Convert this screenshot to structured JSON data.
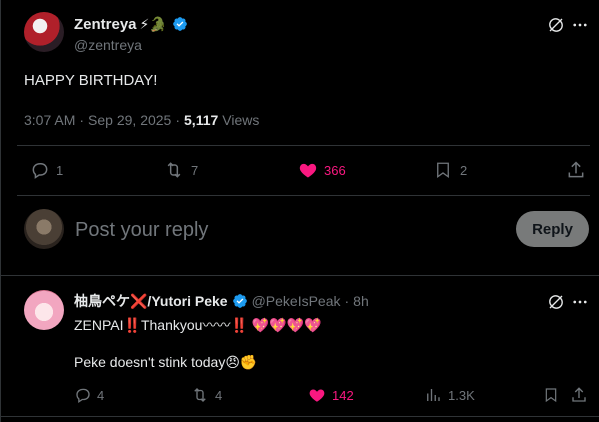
{
  "main_post": {
    "display_name": "Zentreya",
    "name_emojis": "⚡🐊",
    "handle": "@zentreya",
    "text": "HAPPY BIRTHDAY!",
    "time": "3:07 AM",
    "sep": "·",
    "date": "Sep 29, 2025",
    "views_count": "5,117",
    "views_label": "Views",
    "replies": "1",
    "reposts": "7",
    "likes": "366",
    "bookmarks": "2"
  },
  "composer": {
    "placeholder": "Post your reply",
    "reply_label": "Reply"
  },
  "reply_post": {
    "display_name": "柚鳥ペケ❌/Yutori Peke",
    "handle": "@PekeIsPeak",
    "sep": "·",
    "time": "8h",
    "line1": "ZENPAI‼️Thankyou〰〰‼️ 💖💖💖💖",
    "line2": "Peke doesn't stink today😠✊",
    "replies": "4",
    "reposts": "4",
    "likes": "142",
    "views": "1.3K"
  },
  "colors": {
    "background": "#000000",
    "text": "#e7e9ea",
    "muted": "#71767b",
    "like": "#f91880",
    "verified": "#1d9bf0",
    "divider": "#2f3336"
  }
}
